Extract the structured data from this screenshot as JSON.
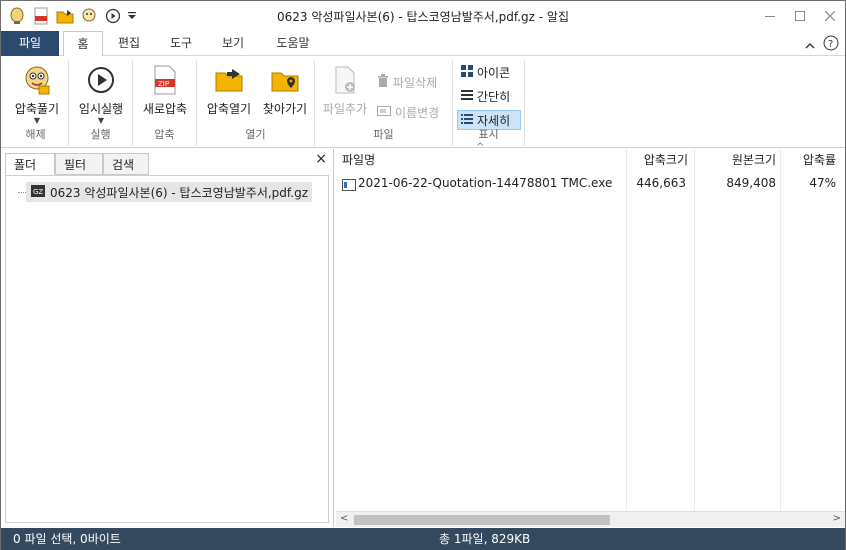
{
  "window": {
    "title": "0623 악성파일사본(6) - 탑스코영남발주서,pdf.gz - 알집"
  },
  "ribbon_tabs": [
    "파일",
    "홈",
    "편집",
    "도구",
    "보기",
    "도움말"
  ],
  "ribbon": {
    "groups": {
      "extract": {
        "label": "해제",
        "btn": "압축풀기"
      },
      "run": {
        "label": "실행",
        "btn": "임시실행"
      },
      "compress": {
        "label": "압축",
        "btn": "새로압축"
      },
      "open": {
        "label": "열기",
        "btn1": "압축열기",
        "btn2": "찾아가기"
      },
      "file": {
        "label": "파일",
        "add": "파일추가",
        "delete": "파일삭제",
        "rename": "이름변경"
      },
      "view": {
        "label": "표시",
        "icons": "아이콘",
        "brief": "간단히",
        "detail": "자세히"
      }
    }
  },
  "left_panel": {
    "tabs": [
      "폴더",
      "필터",
      "검색"
    ],
    "close": "×",
    "tree_item": "0623 악성파일사본(6) - 탑스코영남발주서,pdf.gz"
  },
  "file_list": {
    "columns": [
      "파일명",
      "압축크기",
      "원본크기",
      "압축률"
    ],
    "rows": [
      {
        "name": "2021-06-22-Quotation-14478801  TMC.exe",
        "compressed": "446,663",
        "original": "849,408",
        "ratio": "47%"
      }
    ]
  },
  "status": {
    "left": "0 파일 선택,  0바이트",
    "center": "총 1파일,  829KB"
  },
  "colors": {
    "file_tab": "#2b4a6e",
    "status_bar": "#34495e",
    "selected_view": "#cce4f7"
  }
}
